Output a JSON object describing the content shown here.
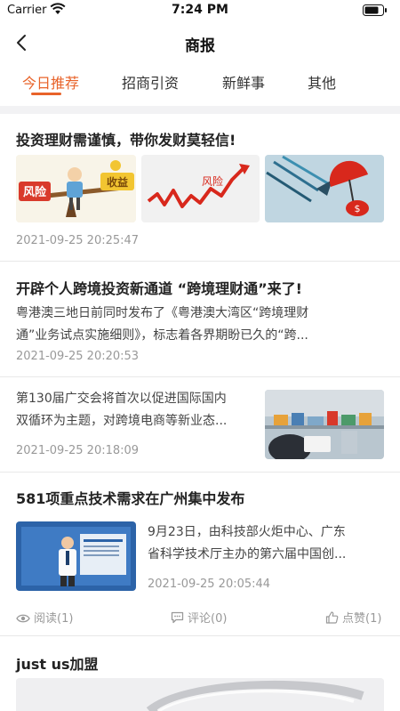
{
  "status": {
    "carrier": "Carrier",
    "time": "7:24 PM"
  },
  "nav": {
    "title": "商报"
  },
  "tabs": [
    {
      "label": "今日推荐"
    },
    {
      "label": "招商引资"
    },
    {
      "label": "新鲜事"
    },
    {
      "label": "其他"
    }
  ],
  "articles": [
    {
      "title": "投资理财需谨慎，带你发财莫轻信!",
      "time": "2021-09-25 20:25:47",
      "image_captions": [
        "风险",
        "收益",
        "风险"
      ]
    },
    {
      "title": "开辟个人跨境投资新通道 “跨境理财通”来了!",
      "summary_line1": "粤港澳三地日前同时发布了《粤港澳大湾区“跨境理财",
      "summary_line2": "通”业务试点实施细则》，标志着各界期盼已久的“跨...",
      "time": "2021-09-25 20:20:53"
    },
    {
      "summary_line1": "第130届广交会将首次以促进国际国内",
      "summary_line2": "双循环为主题，对跨境电商等新业态...",
      "time": "2021-09-25 20:18:09"
    },
    {
      "title": "581项重点技术需求在广州集中发布",
      "summary_line1": "9月23日，由科技部火炬中心、广东",
      "summary_line2": "省科学技术厅主办的第六届中国创...",
      "time": "2021-09-25 20:05:44",
      "stats": {
        "read": "阅读(1)",
        "comment": "评论(0)",
        "like": "点赞(1)"
      }
    },
    {
      "title": "just us加盟"
    }
  ],
  "colors": {
    "accent": "#e8632a",
    "band": "#f2f2f4"
  }
}
